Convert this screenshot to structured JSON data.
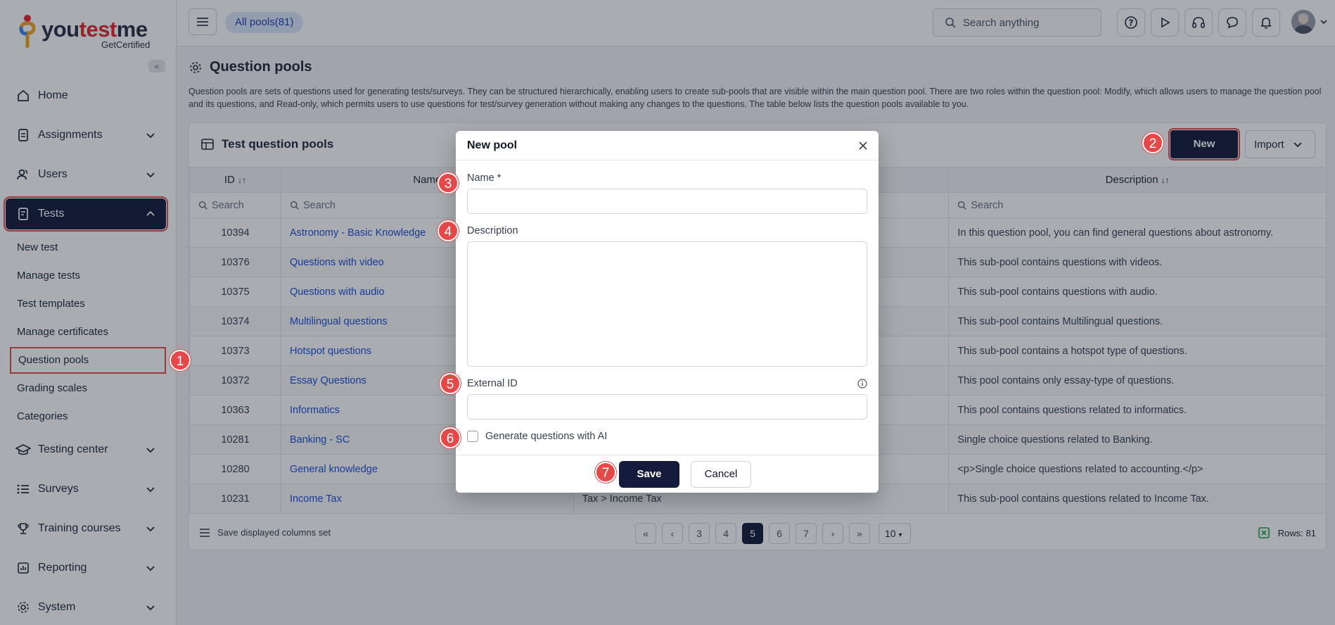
{
  "brand": {
    "name_prefix": "you",
    "name_accent": "test",
    "name_suffix": "me",
    "sub": "GetCertified"
  },
  "sidebar": {
    "collapse_glyph": "«",
    "items": [
      {
        "label": "Home",
        "icon": "home-icon"
      },
      {
        "label": "Assignments",
        "icon": "assignments-icon"
      },
      {
        "label": "Users",
        "icon": "users-icon"
      },
      {
        "label": "Tests",
        "icon": "tests-icon"
      },
      {
        "label": "Testing center",
        "icon": "testing-center-icon"
      },
      {
        "label": "Surveys",
        "icon": "surveys-icon"
      },
      {
        "label": "Training courses",
        "icon": "trophy-icon"
      },
      {
        "label": "Reporting",
        "icon": "reporting-icon"
      },
      {
        "label": "System",
        "icon": "gear-icon"
      }
    ],
    "tests_sub": [
      "New test",
      "Manage tests",
      "Test templates",
      "Manage certificates",
      "Question pools",
      "Grading scales",
      "Categories"
    ]
  },
  "topbar": {
    "chip": "All pools(81)",
    "search_placeholder": "Search anything"
  },
  "page": {
    "title": "Question pools",
    "description": "Question pools are sets of questions used for generating tests/surveys. They can be structured hierarchically, enabling users to create sub-pools that are visible within the main question pool. There are two roles within the question pool: Modify, which allows users to manage the question pool and its questions, and Read-only, which permits users to use questions for test/survey generation without making any changes to the questions. The table below lists the question pools available to you."
  },
  "card": {
    "title": "Test question pools",
    "new_label": "New",
    "import_label": "Import",
    "columns": {
      "id": "ID",
      "name": "Name",
      "description": "Description"
    },
    "search_label": "Search",
    "rows": [
      {
        "id": "10394",
        "name": "Astronomy - Basic Knowledge",
        "path": "",
        "desc": "In this question pool, you can find general questions about astronomy."
      },
      {
        "id": "10376",
        "name": "Questions with video",
        "path": "",
        "desc": "This sub-pool contains questions with videos."
      },
      {
        "id": "10375",
        "name": "Questions with audio",
        "path": "",
        "desc": "This sub-pool contains questions with audio."
      },
      {
        "id": "10374",
        "name": "Multilingual questions",
        "path": "",
        "desc": "This sub-pool contains Multilingual questions."
      },
      {
        "id": "10373",
        "name": "Hotspot questions",
        "path": "",
        "desc": "This sub-pool contains a hotspot type of questions."
      },
      {
        "id": "10372",
        "name": "Essay Questions",
        "path": "",
        "desc": "This pool contains only essay-type of questions."
      },
      {
        "id": "10363",
        "name": "Informatics",
        "path": "",
        "desc": "This pool contains questions related to informatics."
      },
      {
        "id": "10281",
        "name": "Banking - SC",
        "path": "",
        "desc": "Single choice questions related to Banking."
      },
      {
        "id": "10280",
        "name": "General knowledge",
        "path": "",
        "desc": "<p>Single choice questions related to accounting.</p>"
      },
      {
        "id": "10231",
        "name": "Income Tax",
        "path": "Tax > Income Tax",
        "desc": "This sub-pool contains questions related to Income Tax."
      }
    ],
    "footer": {
      "save_cols": "Save displayed columns set",
      "pages": [
        "«",
        "‹",
        "3",
        "4",
        "5",
        "6",
        "7",
        "›",
        "»"
      ],
      "current_page": "5",
      "page_size": "10",
      "rows": "Rows: 81"
    }
  },
  "modal": {
    "title": "New pool",
    "name_label": "Name *",
    "description_label": "Description",
    "external_id_label": "External ID",
    "ai_label": "Generate questions with AI",
    "save": "Save",
    "cancel": "Cancel"
  },
  "markers": [
    "1",
    "2",
    "3",
    "4",
    "5",
    "6",
    "7"
  ],
  "colors": {
    "accent": "#141b3c",
    "marker": "#e54848",
    "link": "#1d4ed8"
  }
}
